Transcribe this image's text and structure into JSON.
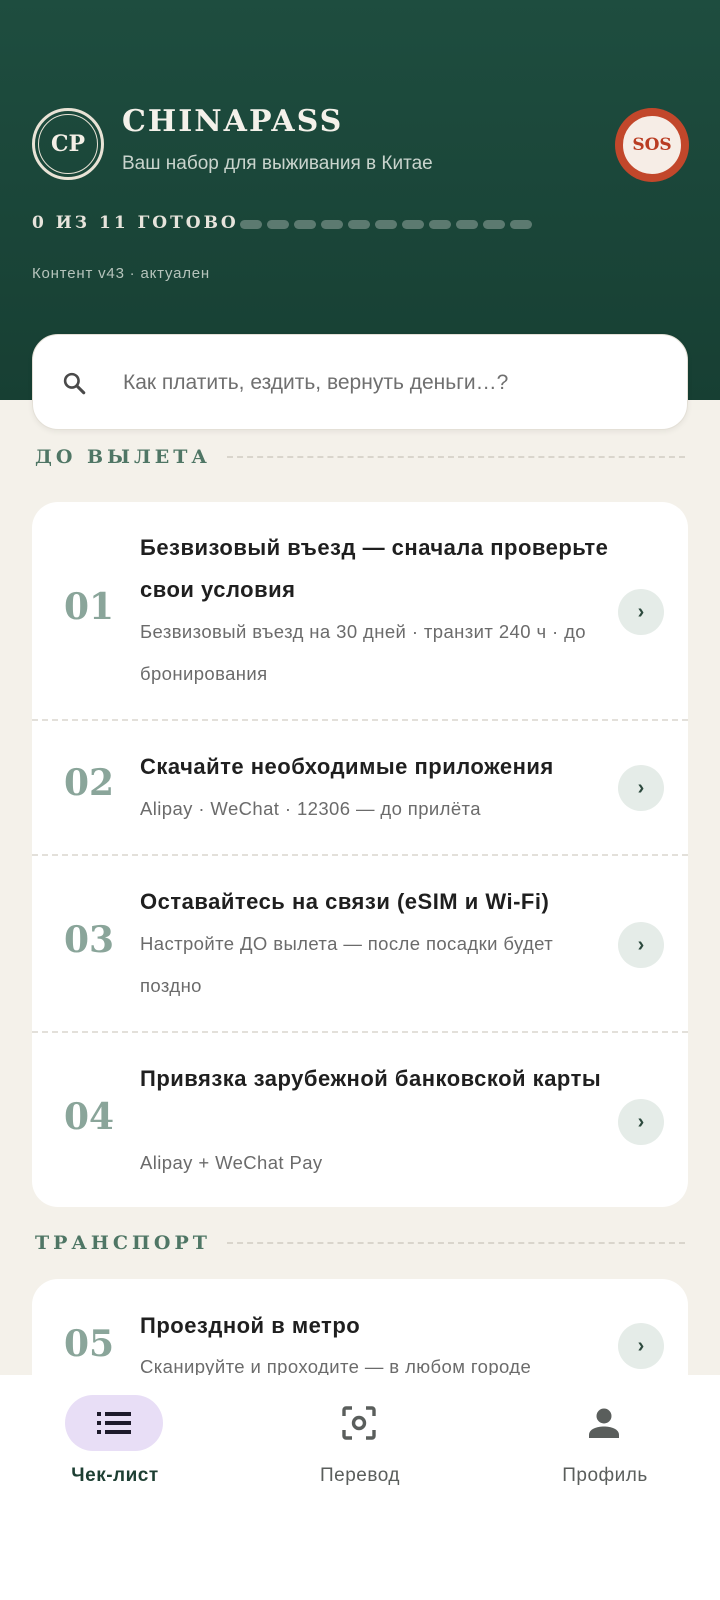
{
  "header": {
    "logo_text": "CP",
    "title": "CHINAPASS",
    "subtitle": "Ваш набор для выживания в Китае",
    "sos_label": "SOS",
    "progress_label": "0 ИЗ 11 ГОТОВО",
    "progress": {
      "done": 0,
      "total": 11
    },
    "content_version": "Контент v43 · актуален"
  },
  "search": {
    "placeholder": "Как платить, ездить, вернуть деньги…?",
    "icon": "search-icon"
  },
  "sections": [
    {
      "title": "ДО ВЫЛЕТА",
      "items": [
        {
          "number": "01",
          "title": "Безвизовый въезд — сначала проверьте свои условия",
          "desc": "Безвизовый въезд на 30 дней · транзит 240 ч · до бронирования",
          "chevron": "›"
        },
        {
          "number": "02",
          "title": "Скачайте необходимые приложения",
          "desc": "Alipay · WeChat · 12306 — до прилёта",
          "chevron": "›"
        },
        {
          "number": "03",
          "title": "Оставайтесь на связи (eSIM и Wi-Fi)",
          "desc": "Настройте ДО вылета — после посадки будет поздно",
          "chevron": "›"
        },
        {
          "number": "04",
          "title": "Привязка зарубежной банковской карты",
          "desc": "Alipay + WeChat Pay",
          "chevron": "›"
        }
      ]
    },
    {
      "title": "ТРАНСПОРТ",
      "items": [
        {
          "number": "05",
          "title": "Проездной в метро",
          "desc": "Сканируйте и проходите — в любом городе",
          "chevron": "›"
        }
      ]
    }
  ],
  "bottom_nav": [
    {
      "label": "Чек-лист",
      "icon": "checklist-icon",
      "active": true
    },
    {
      "label": "Перевод",
      "icon": "camera-scan-icon",
      "active": false
    },
    {
      "label": "Профиль",
      "icon": "person-icon",
      "active": false
    }
  ],
  "colors": {
    "header_bg": "#1e4d3f",
    "page_bg": "#f4f1ea",
    "accent_green": "#4f7665",
    "sos_red": "#c2472b",
    "nav_active_pill": "#e8def6"
  }
}
